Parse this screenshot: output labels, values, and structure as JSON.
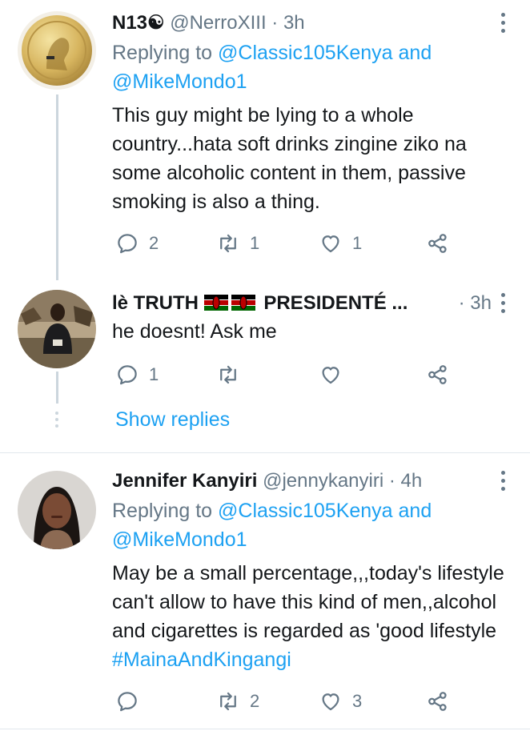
{
  "tweets": [
    {
      "name": "N13☯",
      "handle": "@NerroXIII",
      "time": "3h",
      "replying_prefix": "Replying to ",
      "replying_user1": "@Classic105Kenya",
      "replying_and": " and",
      "replying_user2": "@MikeMondo1",
      "text": "This guy might be lying to a whole country...hata soft drinks zingine ziko na some alcoholic content in them, passive smoking is also a thing.",
      "replies": "2",
      "retweets": "1",
      "likes": "1"
    },
    {
      "name_part1": "lè TRUTH",
      "name_part2": "PRESIDENTÉ ...",
      "time": "3h",
      "text": "he doesnt! Ask me",
      "replies": "1",
      "retweets": "",
      "likes": ""
    },
    {
      "name": "Jennifer Kanyiri",
      "handle": "@jennykanyiri",
      "time": "4h",
      "replying_prefix": "Replying to ",
      "replying_user1": "@Classic105Kenya",
      "replying_and": " and",
      "replying_user2": "@MikeMondo1",
      "text": "May be a small percentage,,,today's lifestyle can't allow to have this kind of men,,alcohol and cigarettes is regarded as 'good lifestyle ",
      "hashtag": "#MainaAndKingangi",
      "replies": "",
      "retweets": "2",
      "likes": "3"
    }
  ],
  "show_replies": "Show replies",
  "separator_dot": "·",
  "icons": [
    "reply-icon",
    "retweet-icon",
    "like-icon",
    "share-icon",
    "more-icon"
  ],
  "colors": {
    "link": "#1da1f2",
    "muted": "#657786",
    "thread": "#ccd6dd"
  }
}
